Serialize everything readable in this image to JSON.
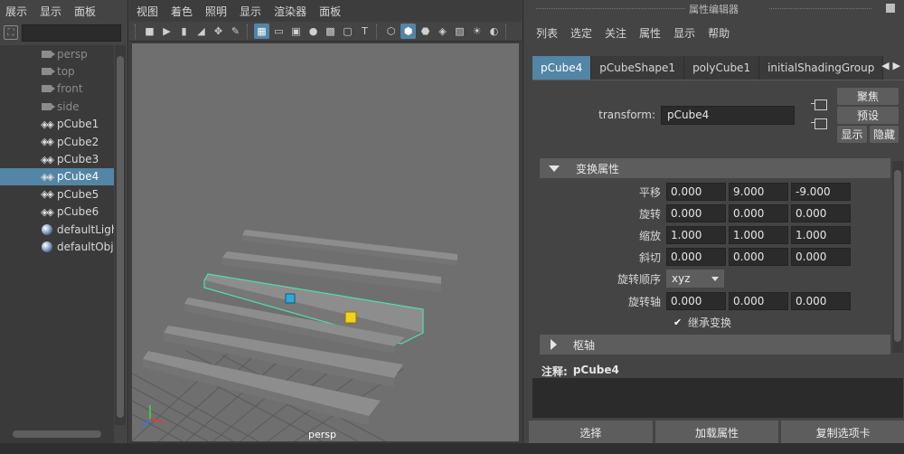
{
  "outliner": {
    "menu": [
      "展示",
      "显示",
      "面板"
    ],
    "items": [
      {
        "label": "persp",
        "kind": "camera",
        "selected": false
      },
      {
        "label": "top",
        "kind": "camera",
        "selected": false
      },
      {
        "label": "front",
        "kind": "camera",
        "selected": false
      },
      {
        "label": "side",
        "kind": "camera",
        "selected": false
      },
      {
        "label": "pCube1",
        "kind": "mesh",
        "selected": false
      },
      {
        "label": "pCube2",
        "kind": "mesh",
        "selected": false
      },
      {
        "label": "pCube3",
        "kind": "mesh",
        "selected": false
      },
      {
        "label": "pCube4",
        "kind": "mesh",
        "selected": true
      },
      {
        "label": "pCube5",
        "kind": "mesh",
        "selected": false
      },
      {
        "label": "pCube6",
        "kind": "mesh",
        "selected": false
      },
      {
        "label": "defaultLigh",
        "kind": "set",
        "selected": false
      },
      {
        "label": "defaultObje",
        "kind": "set",
        "selected": false
      }
    ]
  },
  "viewport": {
    "menu": [
      "视图",
      "着色",
      "照明",
      "显示",
      "渲染器",
      "面板"
    ],
    "camera_label": "persp"
  },
  "attribute_editor": {
    "title": "属性编辑器",
    "menu": [
      "列表",
      "选定",
      "关注",
      "属性",
      "显示",
      "帮助"
    ],
    "tabs": [
      {
        "label": "pCube4",
        "active": true
      },
      {
        "label": "pCubeShape1",
        "active": false
      },
      {
        "label": "polyCube1",
        "active": false
      },
      {
        "label": "initialShadingGroup",
        "active": false
      }
    ],
    "transform_label": "transform:",
    "transform_value": "pCube4",
    "buttons": {
      "focus": "聚焦",
      "presets": "预设",
      "show": "显示",
      "hide": "隐藏"
    },
    "section_transform": "变换属性",
    "section_pivot": "枢轴",
    "rows": {
      "translate": {
        "label": "平移",
        "values": [
          "0.000",
          "9.000",
          "-9.000"
        ]
      },
      "rotate": {
        "label": "旋转",
        "values": [
          "0.000",
          "0.000",
          "0.000"
        ]
      },
      "scale": {
        "label": "缩放",
        "values": [
          "1.000",
          "1.000",
          "1.000"
        ]
      },
      "shear": {
        "label": "斜切",
        "values": [
          "0.000",
          "0.000",
          "0.000"
        ]
      },
      "rotate_order": {
        "label": "旋转顺序",
        "value": "xyz"
      },
      "rotate_axis": {
        "label": "旋转轴",
        "values": [
          "0.000",
          "0.000",
          "0.000"
        ]
      }
    },
    "inherit_label": "继承变换",
    "notes_label": "注释:",
    "notes_value": "pCube4",
    "footer": {
      "select": "选择",
      "load": "加载属性",
      "copy_tab": "复制选项卡"
    }
  },
  "colors": {
    "selection": "#5285a6",
    "panel": "#444444",
    "field": "#2b2b2b",
    "highlight_outline": "#4de0b0"
  }
}
